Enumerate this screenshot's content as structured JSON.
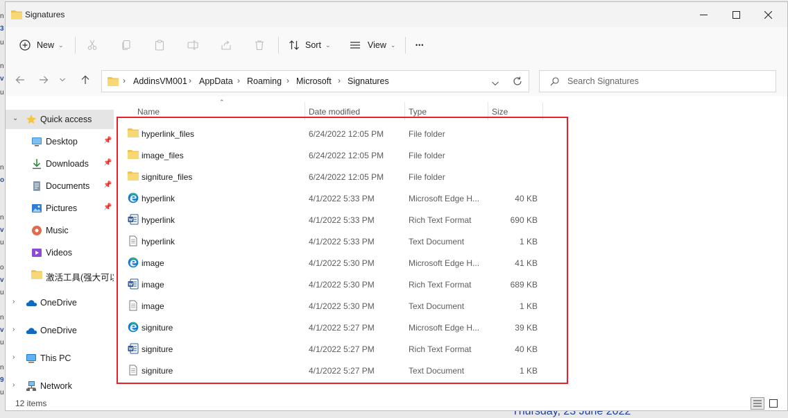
{
  "window": {
    "title": "Signatures"
  },
  "background": {
    "bottom_date": "Thursday, 23 June 2022"
  },
  "commands": {
    "new_label": "New",
    "sort_label": "Sort",
    "view_label": "View",
    "more_label": "•••"
  },
  "address": {
    "crumbs": [
      "AddinsVM001",
      "AppData",
      "Roaming",
      "Microsoft",
      "Signatures"
    ]
  },
  "search": {
    "placeholder": "Search Signatures"
  },
  "sidebar": {
    "items": [
      {
        "label": "Quick access",
        "icon": "star-icon"
      },
      {
        "label": "Desktop",
        "icon": "desktop-icon"
      },
      {
        "label": "Downloads",
        "icon": "download-icon"
      },
      {
        "label": "Documents",
        "icon": "documents-icon"
      },
      {
        "label": "Pictures",
        "icon": "pictures-icon"
      },
      {
        "label": "Music",
        "icon": "music-icon"
      },
      {
        "label": "Videos",
        "icon": "videos-icon"
      },
      {
        "label": "激活工具(强大可以",
        "icon": "folder-icon"
      },
      {
        "label": "OneDrive",
        "icon": "cloud-icon"
      },
      {
        "label": "OneDrive",
        "icon": "cloud-icon"
      },
      {
        "label": "This PC",
        "icon": "pc-icon"
      },
      {
        "label": "Network",
        "icon": "network-icon"
      }
    ]
  },
  "columns": {
    "name": "Name",
    "date": "Date modified",
    "type": "Type",
    "size": "Size"
  },
  "files": [
    {
      "name": "hyperlink_files",
      "date": "6/24/2022 12:05 PM",
      "type": "File folder",
      "size": "",
      "icon": "folder-icon"
    },
    {
      "name": "image_files",
      "date": "6/24/2022 12:05 PM",
      "type": "File folder",
      "size": "",
      "icon": "folder-icon"
    },
    {
      "name": "signiture_files",
      "date": "6/24/2022 12:05 PM",
      "type": "File folder",
      "size": "",
      "icon": "folder-icon"
    },
    {
      "name": "hyperlink",
      "date": "4/1/2022 5:33 PM",
      "type": "Microsoft Edge H...",
      "size": "40 KB",
      "icon": "edge-icon"
    },
    {
      "name": "hyperlink",
      "date": "4/1/2022 5:33 PM",
      "type": "Rich Text Format",
      "size": "690 KB",
      "icon": "word-icon"
    },
    {
      "name": "hyperlink",
      "date": "4/1/2022 5:33 PM",
      "type": "Text Document",
      "size": "1 KB",
      "icon": "text-file-icon"
    },
    {
      "name": "image",
      "date": "4/1/2022 5:30 PM",
      "type": "Microsoft Edge H...",
      "size": "41 KB",
      "icon": "edge-icon"
    },
    {
      "name": "image",
      "date": "4/1/2022 5:30 PM",
      "type": "Rich Text Format",
      "size": "689 KB",
      "icon": "word-icon"
    },
    {
      "name": "image",
      "date": "4/1/2022 5:30 PM",
      "type": "Text Document",
      "size": "1 KB",
      "icon": "text-file-icon"
    },
    {
      "name": "signiture",
      "date": "4/1/2022 5:27 PM",
      "type": "Microsoft Edge H...",
      "size": "39 KB",
      "icon": "edge-icon"
    },
    {
      "name": "signiture",
      "date": "4/1/2022 5:27 PM",
      "type": "Rich Text Format",
      "size": "40 KB",
      "icon": "word-icon"
    },
    {
      "name": "signiture",
      "date": "4/1/2022 5:27 PM",
      "type": "Text Document",
      "size": "1 KB",
      "icon": "text-file-icon"
    }
  ],
  "status": {
    "item_count": "12 items"
  },
  "colors": {
    "highlight": "#e8202a",
    "folder": "#f2c14e",
    "edge": "#0f7bd4",
    "word": "#2b579a"
  }
}
